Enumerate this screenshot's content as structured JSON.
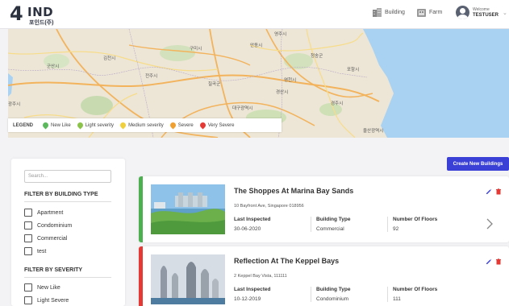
{
  "header": {
    "logo_main": "IND",
    "logo_digit": "4",
    "logo_sub": "포인드(주)",
    "nav": [
      {
        "label": "Building",
        "icon": "building-icon"
      },
      {
        "label": "Farm",
        "icon": "farm-icon"
      }
    ],
    "welcome": "Welcome",
    "username": "TESTUSER"
  },
  "map": {
    "legend_title": "LEGEND",
    "legend": [
      {
        "label": "New Like",
        "color": "#5cb85c"
      },
      {
        "label": "Light severity",
        "color": "#8bc34a"
      },
      {
        "label": "Medium severity",
        "color": "#f0d03c"
      },
      {
        "label": "Severe",
        "color": "#f0a030"
      },
      {
        "label": "Very Severe",
        "color": "#e53935"
      }
    ],
    "labels": [
      "구미시",
      "군산시",
      "전주시",
      "김천시",
      "칠곡군",
      "대구광역시",
      "경산시",
      "영천시",
      "포항시",
      "경주시",
      "광주시",
      "청송군",
      "영주시",
      "안동시",
      "울산광역시"
    ]
  },
  "create_button": "Create New Buildings",
  "sidebar": {
    "search_placeholder": "Search...",
    "filter_type_title": "FILTER BY BUILDING TYPE",
    "types": [
      "Apartment",
      "Condominium",
      "Commercial",
      "test"
    ],
    "filter_severity_title": "FILTER BY SEVERITY",
    "severities": [
      "New Like",
      "Light Severe"
    ]
  },
  "buildings": [
    {
      "name": "The Shoppes At Marina Bay Sands",
      "address": "10 Bayfront Ave, Singapore 018956",
      "last_inspected_label": "Last Inspected",
      "last_inspected": "30-06-2020",
      "type_label": "Building Type",
      "type": "Commercial",
      "floors_label": "Number Of Floors",
      "floors": "92",
      "severity_color": "#4caf50"
    },
    {
      "name": "Reflection At The Keppel Bays",
      "address": "2 Keppel Bay Vista, 111111",
      "last_inspected_label": "Last Inspected",
      "last_inspected": "10-12-2019",
      "type_label": "Building Type",
      "type": "Condominium",
      "floors_label": "Number Of Floors",
      "floors": "111",
      "severity_color": "#e53935"
    }
  ]
}
